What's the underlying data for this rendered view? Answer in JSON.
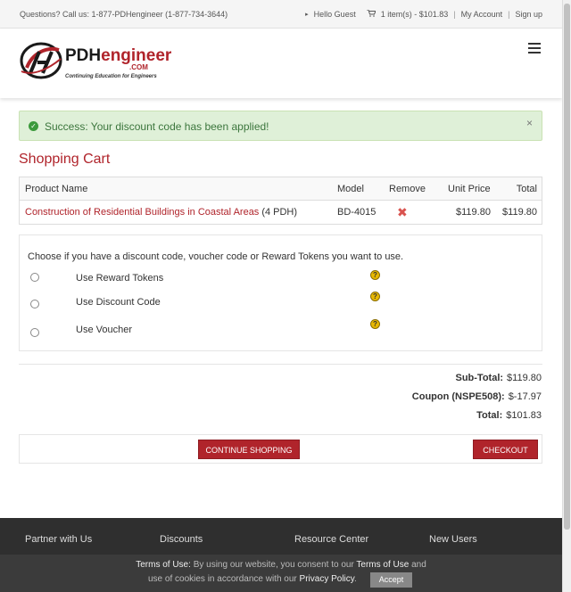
{
  "topbar": {
    "phone": "Questions? Call us: 1-877-PDHengineer (1-877-734-3644)",
    "hello": "Hello Guest",
    "cart_summary": "1 item(s) - $101.83",
    "my_account": "My Account",
    "sign_up": "Sign up"
  },
  "logo": {
    "name_main": "PDH",
    "name_accent": "engineer",
    "name_suffix": ".COM",
    "tagline": "Continuing Education for Engineers",
    "brand_color": "#b0242b"
  },
  "alert": {
    "message": "Success: Your discount code has been applied!",
    "close": "×"
  },
  "cart": {
    "title": "Shopping Cart",
    "headers": [
      "Product Name",
      "Model",
      "Remove",
      "Unit Price",
      "Total"
    ],
    "items": [
      {
        "name": "Construction of Residential Buildings in Coastal Areas",
        "pdh": "(4 PDH)",
        "model": "BD-4015",
        "unit_price": "$119.80",
        "total": "$119.80"
      }
    ]
  },
  "discount": {
    "prompt": "Choose if you have a discount code, voucher code or Reward Tokens you want to use.",
    "options": [
      "Use Reward Tokens",
      "Use Discount Code",
      "Use Voucher"
    ]
  },
  "totals": {
    "subtotal_label": "Sub-Total:",
    "subtotal": "$119.80",
    "coupon_label": "Coupon (NSPE508):",
    "coupon": "$-17.97",
    "total_label": "Total:",
    "total": "$101.83"
  },
  "buttons": {
    "continue": "Continue Shopping",
    "checkout": "Checkout"
  },
  "footer": {
    "columns": [
      "Partner with Us",
      "Discounts",
      "Resource Center",
      "New Users"
    ]
  },
  "cookie": {
    "terms_label": "Terms of Use:",
    "text1": "By using our website, you consent to our",
    "terms_link": "Terms of Use",
    "and": "and",
    "text2": "use of cookies in accordance with our",
    "privacy_link": "Privacy Policy",
    "period": ".",
    "accept": "Accept"
  },
  "icons": {
    "remove": "remove-x-icon",
    "help": "question-icon",
    "menu": "hamburger-menu-icon",
    "cart": "cart-icon",
    "success": "check-circle-icon"
  },
  "colors": {
    "accent": "#b0242b",
    "success_bg": "#dff0d8",
    "success_text": "#3c763d",
    "footer_bg": "#2f2f2f"
  }
}
